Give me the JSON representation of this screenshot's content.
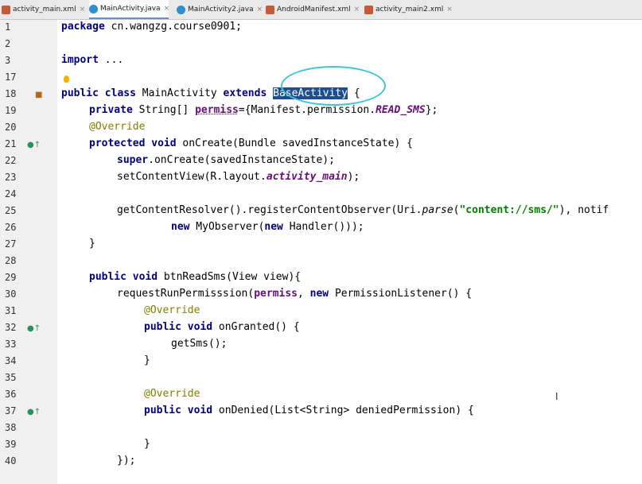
{
  "tabs": [
    {
      "label": "activity_main.xml",
      "type": "xml",
      "active": false
    },
    {
      "label": "MainActivity.java",
      "type": "java",
      "active": true
    },
    {
      "label": "MainActivity2.java",
      "type": "java",
      "active": false
    },
    {
      "label": "AndroidManifest.xml",
      "type": "xml",
      "active": false
    },
    {
      "label": "activity_main2.xml",
      "type": "xml",
      "active": false
    }
  ],
  "tab_close_glyph": "×",
  "line_numbers": [
    "1",
    "2",
    "3",
    "17",
    "18",
    "19",
    "20",
    "21",
    "22",
    "23",
    "24",
    "25",
    "26",
    "27",
    "28",
    "29",
    "30",
    "31",
    "32",
    "33",
    "34",
    "35",
    "36",
    "37",
    "38",
    "39",
    "40"
  ],
  "code": {
    "l1_kw": "package",
    "l1_rest": " cn.wangzg.course0901;",
    "l3_kw": "import",
    "l3_rest": " ...",
    "l18_kw": "public class",
    "l18_name": " MainActivity ",
    "l18_kw2": "extends",
    "l18_sp": " ",
    "l18_sel": "BaseActivity",
    "l18_end": " {",
    "l19_kw": "private",
    "l19_a": " String[] ",
    "l19_field": "permiss",
    "l19_b": "={Manifest.permission.",
    "l19_const": "READ_SMS",
    "l19_c": "};",
    "l20_ann": "@Override",
    "l21_kw": "protected void",
    "l21_rest": " onCreate(Bundle savedInstanceState) {",
    "l22_kw": "super",
    "l22_rest": ".onCreate(savedInstanceState);",
    "l23_a": "setContentView(R.layout.",
    "l23_field": "activity_main",
    "l23_b": ");",
    "l25_a": "getContentResolver().registerContentObserver(Uri.",
    "l25_ital": "parse",
    "l25_b": "(",
    "l25_str": "\"content://sms/\"",
    "l25_c": "), notif",
    "l26_kw": "new",
    "l26_a": " MyObserver(",
    "l26_kw2": "new",
    "l26_b": " Handler()));",
    "l27": "}",
    "l29_kw": "public void",
    "l29_rest": " btnReadSms(View view){",
    "l30_a": "requestRunPermisssion(",
    "l30_field": "permiss",
    "l30_b": ", ",
    "l30_kw": "new",
    "l30_c": " PermissionListener() {",
    "l31_ann": "@Override",
    "l32_kw": "public void",
    "l32_rest": " onGranted() {",
    "l33": "getSms();",
    "l34": "}",
    "l36_ann": "@Override",
    "l37_kw": "public void",
    "l37_rest": " onDenied(List<String> deniedPermission) {",
    "l39": "}",
    "l40": "});"
  },
  "icons": {
    "override": "override-up-arrow-icon",
    "class": "class-hierarchy-icon",
    "bulb": "intention-bulb-icon"
  },
  "colors": {
    "keyword": "#000080",
    "string": "#008000",
    "annotation": "#808000",
    "field": "#660e7a",
    "selection": "#1b4f8f",
    "highlight_circle": "#3fc4d6"
  }
}
